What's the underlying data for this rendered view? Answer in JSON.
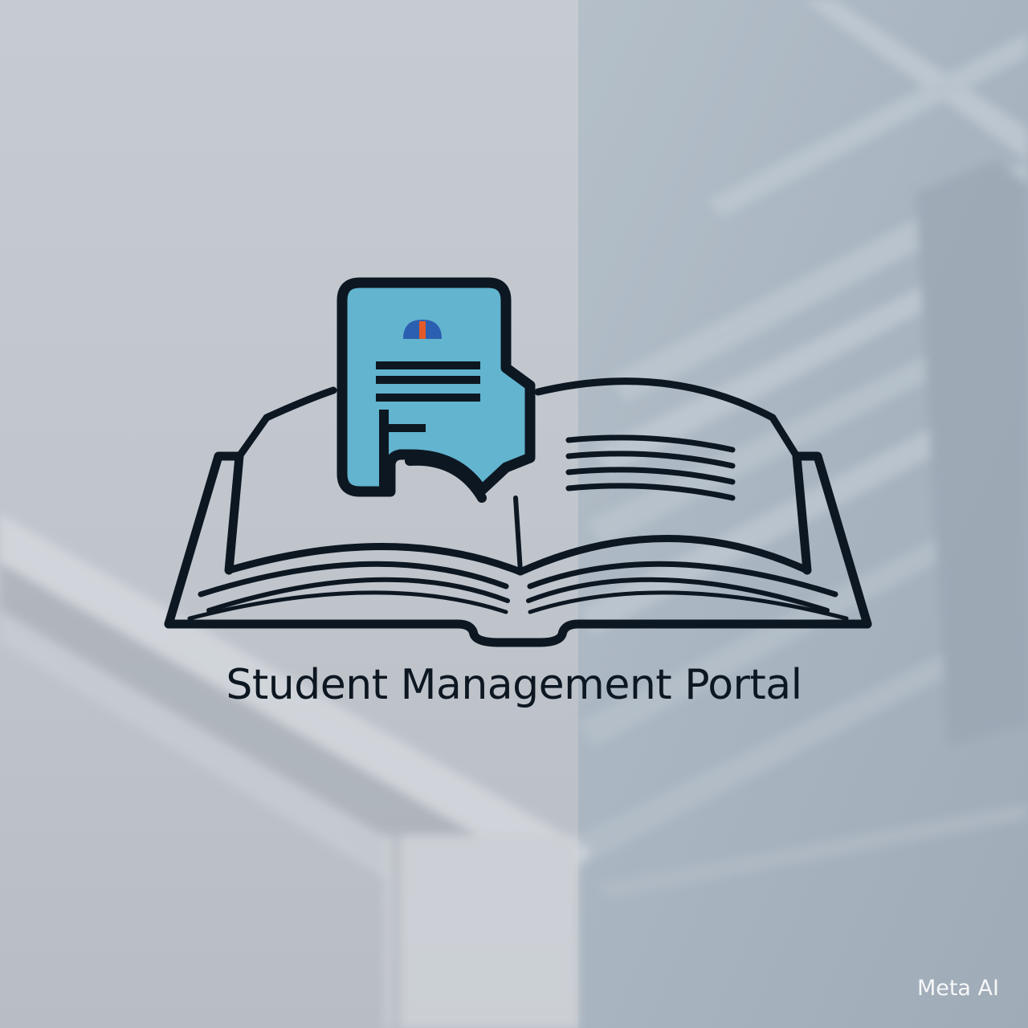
{
  "brand": {
    "title": "Student Management Portal",
    "watermark": "Meta AI"
  },
  "icons": {
    "logo": "open-book-with-student-id-card-icon",
    "background": "blurred-ceiling-interior"
  },
  "colors": {
    "ink": "#0d1722",
    "card_fill": "#62b4cf",
    "badge_blue": "#2b5fb0",
    "badge_orange": "#e35a28",
    "background_left": "#c4c9d0",
    "background_right": "#a9b6c2",
    "watermark": "#ffffff"
  }
}
